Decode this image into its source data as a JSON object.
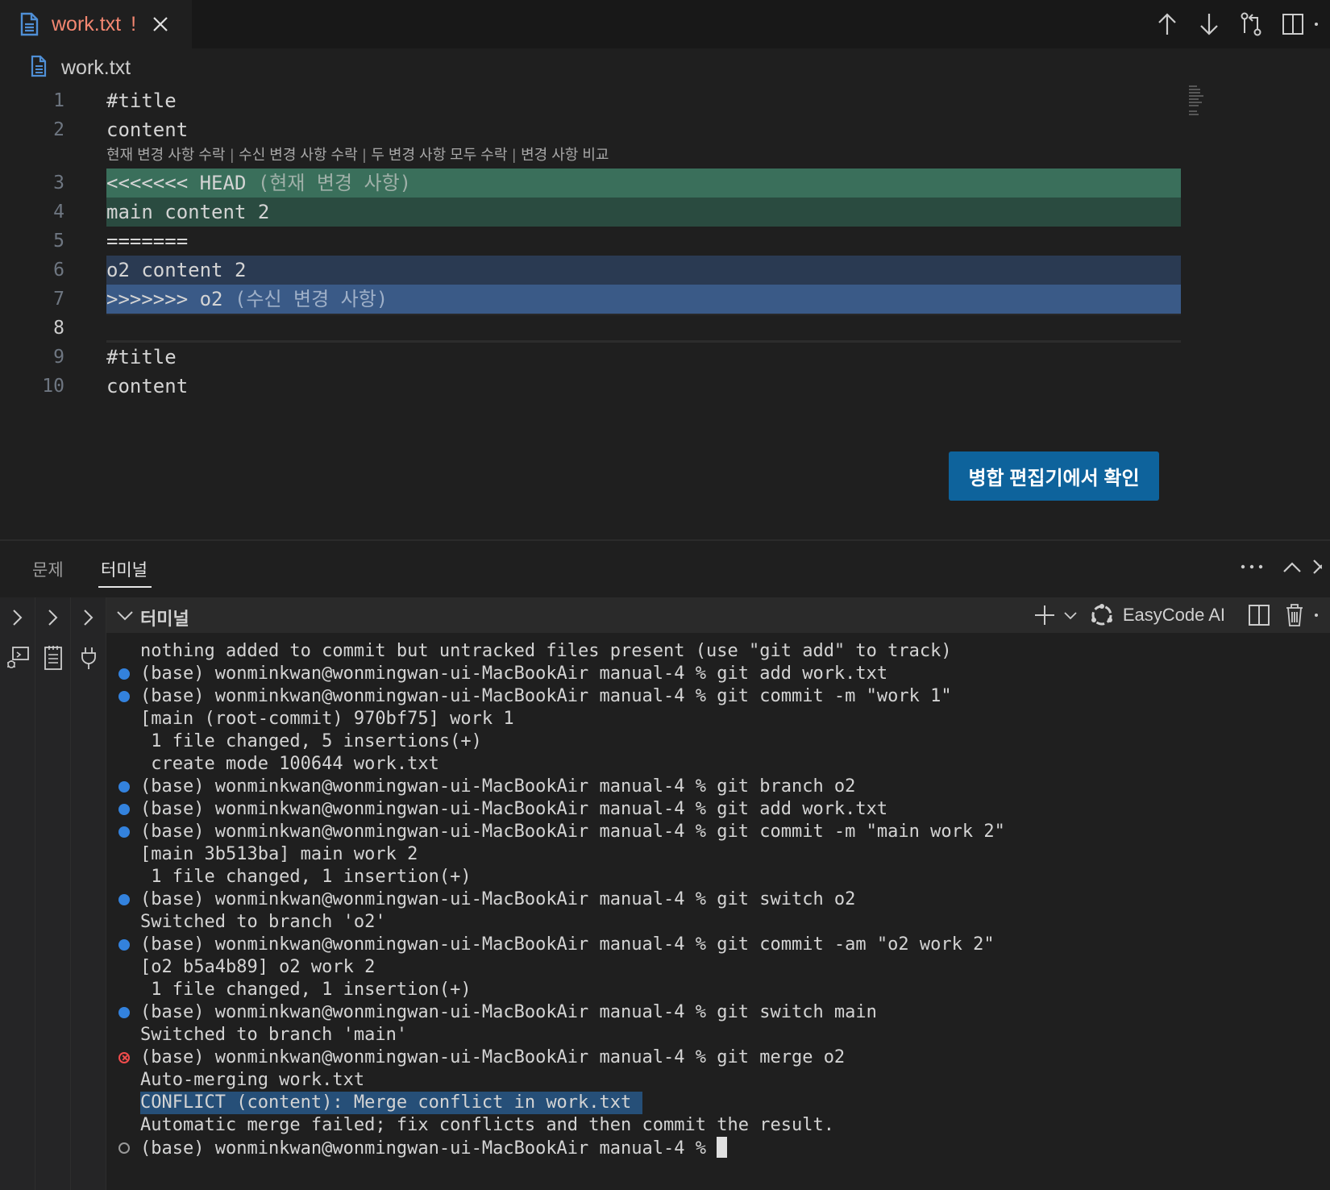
{
  "tab": {
    "filename": "work.txt",
    "modified_mark": "!"
  },
  "breadcrumb": {
    "file": "work.txt"
  },
  "editor": {
    "lines": [
      {
        "num": "1",
        "text": "#title"
      },
      {
        "num": "2",
        "text": "content"
      },
      {
        "num": "3",
        "text": "<<<<<<< HEAD",
        "hint": " (현재 변경 사항)"
      },
      {
        "num": "4",
        "text": "main content 2"
      },
      {
        "num": "5",
        "text": "======="
      },
      {
        "num": "6",
        "text": "o2 content 2"
      },
      {
        "num": "7",
        "text": ">>>>>>> o2",
        "hint": " (수신 변경 사항)"
      },
      {
        "num": "8",
        "text": ""
      },
      {
        "num": "9",
        "text": "#title"
      },
      {
        "num": "10",
        "text": "content"
      }
    ],
    "codelens": [
      "현재 변경 사항 수락",
      "수신 변경 사항 수락",
      "두 변경 사항 모두 수락",
      "변경 사항 비교"
    ],
    "codelens_separator": "|",
    "merge_button": "병합 편집기에서 확인"
  },
  "panel": {
    "tabs": [
      "문제",
      "터미널"
    ],
    "active_tab": "터미널",
    "terminal_title": "터미널",
    "profile_name": "EasyCode AI"
  },
  "terminal": {
    "lines": [
      {
        "status": "none",
        "text": "nothing added to commit but untracked files present (use \"git add\" to track)"
      },
      {
        "status": "ok",
        "text": "(base) wonminkwan@wonmingwan-ui-MacBookAir manual-4 % git add work.txt"
      },
      {
        "status": "ok",
        "text": "(base) wonminkwan@wonmingwan-ui-MacBookAir manual-4 % git commit -m \"work 1\""
      },
      {
        "status": "none",
        "text": "[main (root-commit) 970bf75] work 1"
      },
      {
        "status": "none",
        "text": " 1 file changed, 5 insertions(+)"
      },
      {
        "status": "none",
        "text": " create mode 100644 work.txt"
      },
      {
        "status": "ok",
        "text": "(base) wonminkwan@wonmingwan-ui-MacBookAir manual-4 % git branch o2"
      },
      {
        "status": "ok",
        "text": "(base) wonminkwan@wonmingwan-ui-MacBookAir manual-4 % git add work.txt"
      },
      {
        "status": "ok",
        "text": "(base) wonminkwan@wonmingwan-ui-MacBookAir manual-4 % git commit -m \"main work 2\""
      },
      {
        "status": "none",
        "text": "[main 3b513ba] main work 2"
      },
      {
        "status": "none",
        "text": " 1 file changed, 1 insertion(+)"
      },
      {
        "status": "ok",
        "text": "(base) wonminkwan@wonmingwan-ui-MacBookAir manual-4 % git switch o2"
      },
      {
        "status": "none",
        "text": "Switched to branch 'o2'"
      },
      {
        "status": "ok",
        "text": "(base) wonminkwan@wonmingwan-ui-MacBookAir manual-4 % git commit -am \"o2 work 2\""
      },
      {
        "status": "none",
        "text": "[o2 b5a4b89] o2 work 2"
      },
      {
        "status": "none",
        "text": " 1 file changed, 1 insertion(+)"
      },
      {
        "status": "ok",
        "text": "(base) wonminkwan@wonmingwan-ui-MacBookAir manual-4 % git switch main"
      },
      {
        "status": "none",
        "text": "Switched to branch 'main'"
      },
      {
        "status": "error",
        "text": "(base) wonminkwan@wonmingwan-ui-MacBookAir manual-4 % git merge o2"
      },
      {
        "status": "none",
        "text": "Auto-merging work.txt"
      },
      {
        "status": "none",
        "text": "CONFLICT (content): Merge conflict in work.txt",
        "selected": true
      },
      {
        "status": "none",
        "text": "Automatic merge failed; fix conflicts and then commit the result."
      },
      {
        "status": "pending",
        "text": "(base) wonminkwan@wonmingwan-ui-MacBookAir manual-4 % "
      }
    ]
  },
  "colors": {
    "accent": "#0e639c",
    "current_change_header": "#3a6f5b",
    "current_change": "#2a4b40",
    "incoming_change": "#2a3a52",
    "incoming_change_header": "#3a5a87",
    "tab_modified": "#f48771",
    "status_ok": "#3794ff",
    "status_error": "#f14c4c"
  }
}
